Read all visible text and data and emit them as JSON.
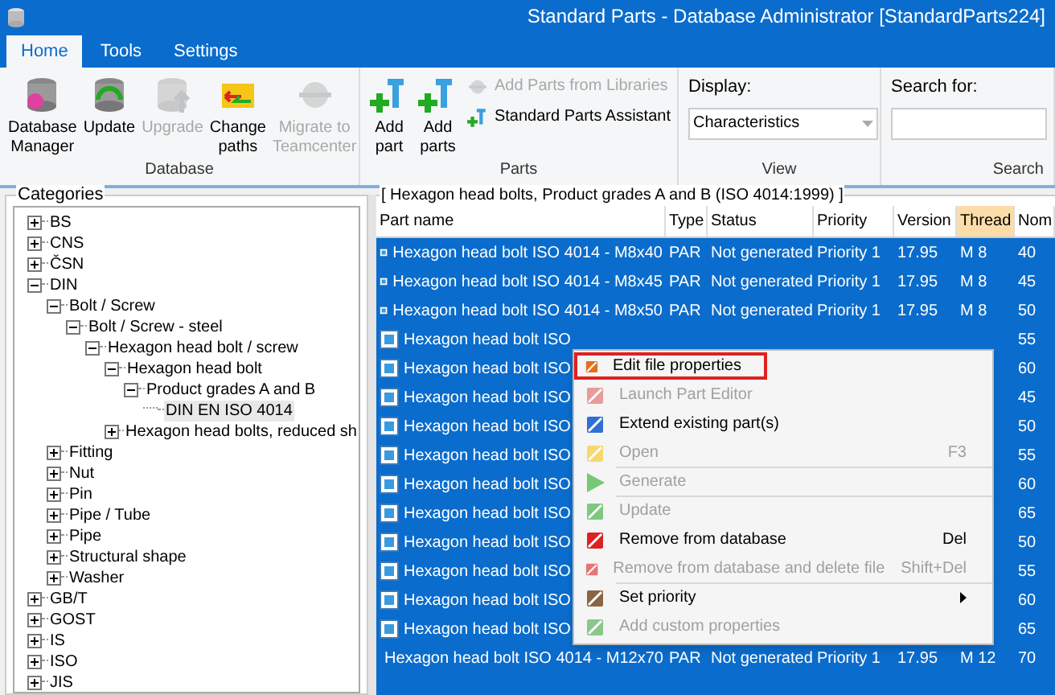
{
  "window": {
    "title": "Standard Parts - Database Administrator [StandardParts224]"
  },
  "tabs": [
    {
      "label": "Home",
      "selected": true
    },
    {
      "label": "Tools",
      "selected": false
    },
    {
      "label": "Settings",
      "selected": false
    }
  ],
  "ribbon": {
    "groups": [
      {
        "label": "Database",
        "buttons": [
          {
            "label": "Database Manager",
            "disabled": false
          },
          {
            "label": "Update",
            "disabled": false
          },
          {
            "label": "Upgrade",
            "disabled": true
          },
          {
            "label": "Change paths",
            "disabled": false
          },
          {
            "label": "Migrate to Teamcenter",
            "disabled": true
          }
        ]
      },
      {
        "label": "Parts",
        "buttons": [
          {
            "label": "Add part",
            "disabled": false
          },
          {
            "label": "Add parts",
            "disabled": false
          }
        ],
        "small_buttons": [
          {
            "label": "Add Parts from Libraries",
            "disabled": true
          },
          {
            "label": "Standard Parts Assistant",
            "disabled": false
          }
        ]
      },
      {
        "label": "View",
        "display_label": "Display:",
        "display_value": "Characteristics"
      },
      {
        "label": "Search",
        "search_label": "Search for:"
      }
    ]
  },
  "categories": {
    "title": "Categories",
    "items": [
      {
        "label": "BS",
        "expanded": false
      },
      {
        "label": "CNS",
        "expanded": false
      },
      {
        "label": "ČSN",
        "expanded": false
      },
      {
        "label": "DIN",
        "expanded": true,
        "children": [
          {
            "label": "Bolt / Screw",
            "expanded": true,
            "children": [
              {
                "label": "Bolt / Screw - steel",
                "expanded": true,
                "children": [
                  {
                    "label": "Hexagon head bolt / screw",
                    "expanded": true,
                    "children": [
                      {
                        "label": "Hexagon head bolt",
                        "expanded": true,
                        "children": [
                          {
                            "label": "Product grades A and B",
                            "expanded": true,
                            "children": [
                              {
                                "label": "DIN EN ISO 4014",
                                "selected": true
                              }
                            ]
                          }
                        ]
                      },
                      {
                        "label": "Hexagon head bolts, reduced sh",
                        "expanded": false
                      }
                    ]
                  }
                ]
              }
            ]
          },
          {
            "label": "Fitting",
            "expanded": false
          },
          {
            "label": "Nut",
            "expanded": false
          },
          {
            "label": "Pin",
            "expanded": false
          },
          {
            "label": "Pipe / Tube",
            "expanded": false
          },
          {
            "label": "Pipe",
            "expanded": false
          },
          {
            "label": "Structural shape",
            "expanded": false
          },
          {
            "label": "Washer",
            "expanded": false
          }
        ]
      },
      {
        "label": "GB/T",
        "expanded": false
      },
      {
        "label": "GOST",
        "expanded": false
      },
      {
        "label": "IS",
        "expanded": false
      },
      {
        "label": "ISO",
        "expanded": false
      },
      {
        "label": "JIS",
        "expanded": false
      }
    ]
  },
  "table": {
    "title": "[ Hexagon head bolts, Product grades A and B (ISO 4014:1999) ]",
    "columns": [
      {
        "label": "Part name",
        "sorted": false
      },
      {
        "label": "Type",
        "sorted": false
      },
      {
        "label": "Status",
        "sorted": false
      },
      {
        "label": "Priority",
        "sorted": false
      },
      {
        "label": "Version",
        "sorted": false
      },
      {
        "label": "Thread",
        "sorted": true
      },
      {
        "label": "Nom",
        "sorted": false
      }
    ],
    "rows": [
      {
        "selected": true,
        "cells": [
          "Hexagon head bolt ISO 4014 - M8x40",
          "PAR",
          "Not generated",
          "Priority 1",
          "17.95",
          "M 8",
          "40"
        ]
      },
      {
        "selected": true,
        "cells": [
          "Hexagon head bolt ISO 4014 - M8x45",
          "PAR",
          "Not generated",
          "Priority 1",
          "17.95",
          "M 8",
          "45"
        ]
      },
      {
        "selected": true,
        "cells": [
          "Hexagon head bolt ISO 4014 - M8x50",
          "PAR",
          "Not generated",
          "Priority 1",
          "17.95",
          "M 8",
          "50"
        ]
      },
      {
        "selected": true,
        "cells": [
          "Hexagon head bolt ISO",
          "",
          "",
          "",
          "",
          "",
          "55"
        ]
      },
      {
        "selected": true,
        "cells": [
          "Hexagon head bolt ISO",
          "",
          "",
          "",
          "",
          "",
          "60"
        ]
      },
      {
        "selected": true,
        "cells": [
          "Hexagon head bolt ISO",
          "",
          "",
          "",
          "",
          "",
          "45"
        ]
      },
      {
        "selected": true,
        "cells": [
          "Hexagon head bolt ISO",
          "",
          "",
          "",
          "",
          "",
          "50"
        ]
      },
      {
        "selected": true,
        "cells": [
          "Hexagon head bolt ISO",
          "",
          "",
          "",
          "",
          "",
          "55"
        ]
      },
      {
        "selected": true,
        "cells": [
          "Hexagon head bolt ISO",
          "",
          "",
          "",
          "",
          "",
          "60"
        ]
      },
      {
        "selected": true,
        "cells": [
          "Hexagon head bolt ISO",
          "",
          "",
          "",
          "",
          "",
          "65"
        ]
      },
      {
        "selected": true,
        "cells": [
          "Hexagon head bolt ISO",
          "",
          "",
          "",
          "",
          "",
          "50"
        ]
      },
      {
        "selected": true,
        "cells": [
          "Hexagon head bolt ISO",
          "",
          "",
          "",
          "",
          "",
          "55"
        ]
      },
      {
        "selected": true,
        "cells": [
          "Hexagon head bolt ISO",
          "",
          "",
          "",
          "",
          "",
          "60"
        ]
      },
      {
        "selected": true,
        "cells": [
          "Hexagon head bolt ISO",
          "",
          "",
          "",
          "",
          "",
          "65"
        ]
      },
      {
        "selected": true,
        "cells": [
          "Hexagon head bolt ISO 4014 - M12x70",
          "PAR",
          "Not generated",
          "Priority 1",
          "17.95",
          "M 12",
          "70"
        ]
      }
    ]
  },
  "context_menu": {
    "items": [
      {
        "label": "Edit file properties",
        "disabled": false,
        "highlighted": true,
        "separator_after": false
      },
      {
        "label": "Launch Part Editor",
        "disabled": true,
        "highlighted": false,
        "separator_after": false
      },
      {
        "label": "Extend existing part(s)",
        "disabled": false,
        "highlighted": false,
        "separator_after": false
      },
      {
        "label": "Open",
        "shortcut": "F3",
        "disabled": true,
        "highlighted": false,
        "separator_after": true
      },
      {
        "label": "Generate",
        "disabled": true,
        "highlighted": false,
        "separator_after": true
      },
      {
        "label": "Update",
        "disabled": true,
        "highlighted": false,
        "separator_after": false
      },
      {
        "label": "Remove from database",
        "shortcut": "Del",
        "disabled": false,
        "highlighted": false,
        "separator_after": false
      },
      {
        "label": "Remove from database and delete file",
        "shortcut": "Shift+Del",
        "disabled": true,
        "highlighted": false,
        "separator_after": true
      },
      {
        "label": "Set priority",
        "disabled": false,
        "highlighted": false,
        "submenu": true,
        "separator_after": false
      },
      {
        "label": "Add custom properties",
        "disabled": true,
        "highlighted": false,
        "separator_after": false
      }
    ]
  }
}
